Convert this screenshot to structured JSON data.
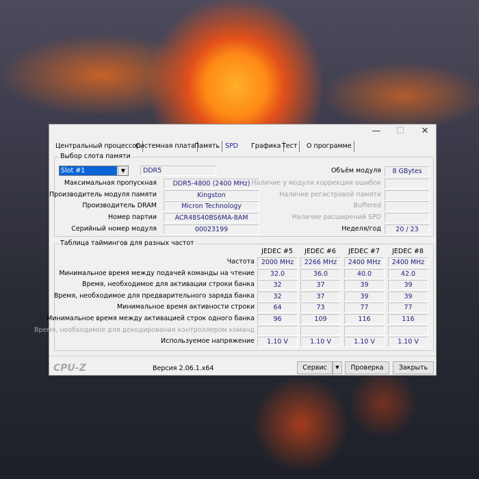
{
  "window": {
    "minimize": "—",
    "maximize": "☐",
    "close": "✕"
  },
  "tabs": [
    {
      "label": "Центральный процессор"
    },
    {
      "label": "Системная плата"
    },
    {
      "label": "Память"
    },
    {
      "label": "SPD",
      "active": true
    },
    {
      "label": "Графика"
    },
    {
      "label": "Тест"
    },
    {
      "label": "О программе"
    }
  ],
  "slot": {
    "title": "Выбор слота памяти",
    "selected": "Slot #1",
    "type": "DDR5",
    "left": [
      {
        "label": "Максимальная пропускная",
        "value": "DDR5-4800 (2400 MHz)"
      },
      {
        "label": "Производитель модуля памяти",
        "value": "Kingston"
      },
      {
        "label": "Производитель DRAM",
        "value": "Micron Technology"
      },
      {
        "label": "Номер партии",
        "value": "ACR48S40BS6MA-8AM"
      },
      {
        "label": "Серийный номер модуля",
        "value": "00023199"
      }
    ],
    "right": [
      {
        "label": "Объём модуля",
        "value": "8 GBytes",
        "enabled": true
      },
      {
        "label": "Наличие у модуля коррекции ошибок",
        "value": "",
        "enabled": false
      },
      {
        "label": "Наличие регистровой памяти",
        "value": "",
        "enabled": false
      },
      {
        "label": "Buffered",
        "value": "",
        "enabled": false
      },
      {
        "label": "Наличие расширений SPD",
        "value": "",
        "enabled": false
      },
      {
        "label": "Неделя/год",
        "value": "20 / 23",
        "enabled": true
      }
    ]
  },
  "timings": {
    "title": "Таблица таймингов для разных частот",
    "columns": [
      "JEDEC #5",
      "JEDEC #6",
      "JEDEC #7",
      "JEDEC #8"
    ],
    "rows": [
      {
        "label": "Частота",
        "values": [
          "2000 MHz",
          "2266 MHz",
          "2400 MHz",
          "2400 MHz"
        ],
        "enabled": true
      },
      {
        "label": "Минимальное время между подачей команды на чтение",
        "values": [
          "32.0",
          "36.0",
          "40.0",
          "42.0"
        ],
        "enabled": true
      },
      {
        "label": "Время, необходимое для активации строки банка",
        "values": [
          "32",
          "37",
          "39",
          "39"
        ],
        "enabled": true
      },
      {
        "label": "Время, необходимое для предварительного заряда банка",
        "values": [
          "32",
          "37",
          "39",
          "39"
        ],
        "enabled": true
      },
      {
        "label": "Минимальное время активности строки",
        "values": [
          "64",
          "73",
          "77",
          "77"
        ],
        "enabled": true
      },
      {
        "label": "Минимальное время между активацией строк одного банка",
        "values": [
          "96",
          "109",
          "116",
          "116"
        ],
        "enabled": true
      },
      {
        "label": "Время, необходимое для декодирования контроллером команд",
        "values": [
          "",
          "",
          "",
          ""
        ],
        "enabled": false
      },
      {
        "label": "Используемое напряжение",
        "values": [
          "1.10 V",
          "1.10 V",
          "1.10 V",
          "1.10 V"
        ],
        "enabled": true
      }
    ]
  },
  "footer": {
    "brand": "CPU-Z",
    "version": "Версия 2.06.1.x64",
    "tools": "Сервис",
    "validate": "Проверка",
    "close": "Закрыть"
  }
}
